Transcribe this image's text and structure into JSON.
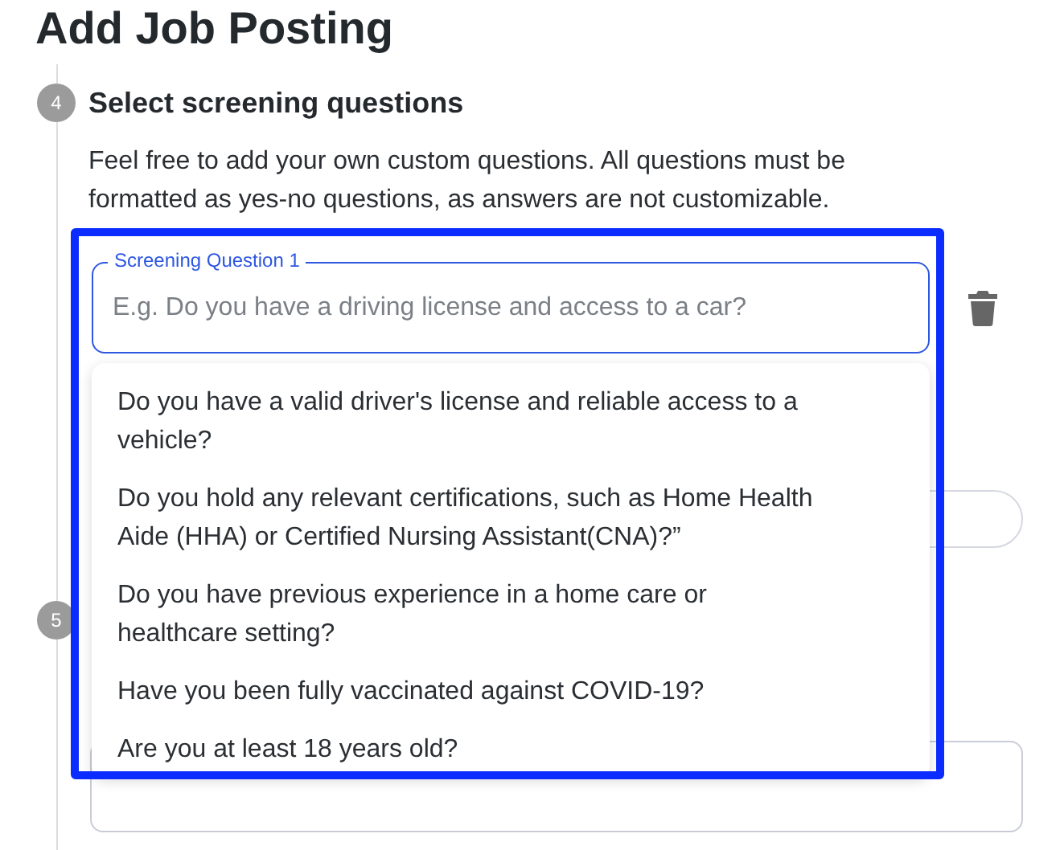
{
  "page_title": "Add Job Posting",
  "steps": [
    {
      "number": "4",
      "title": "Select screening questions",
      "description": "Feel free to add your own custom questions. All questions must be formatted as yes-no questions, as answers are not customizable.",
      "questions": [
        {
          "label": "Screening Question 1",
          "placeholder": "E.g. Do you have a driving license and access to a car?",
          "focused": true
        }
      ],
      "suggestions": [
        "Do you have a valid driver's license and reliable access to a vehicle?",
        "Do you hold any relevant certifications, such as Home Health Aide (HHA) or Certified Nursing Assistant(CNA)?”",
        "Do you have previous experience in a home care or healthcare setting?",
        "Have you been fully vaccinated against COVID-19?",
        "Are you at least 18 years old?"
      ]
    },
    {
      "number": "5"
    }
  ],
  "highlight": {
    "shown": true
  }
}
